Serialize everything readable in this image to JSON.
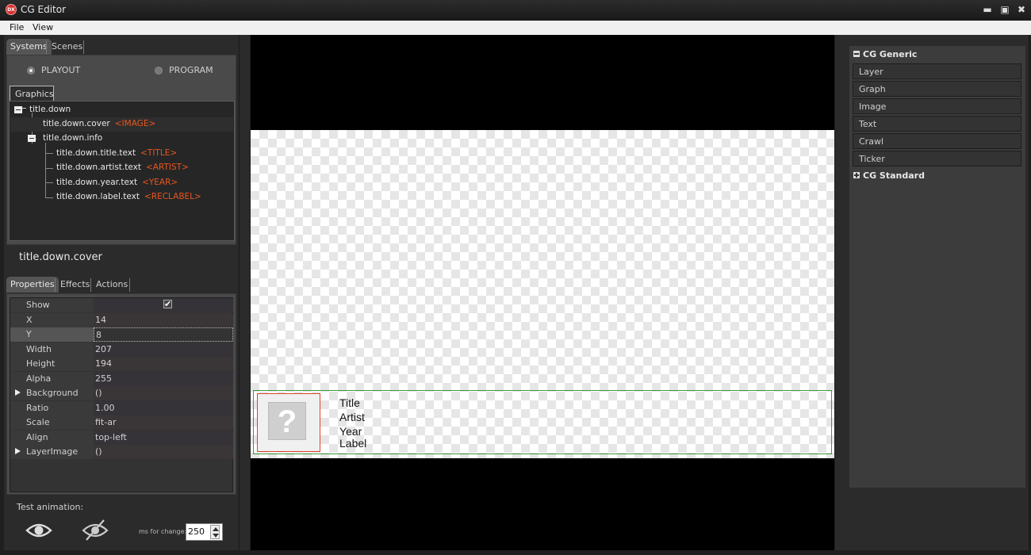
{
  "window": {
    "app_icon_label": "DX",
    "title": "CG Editor",
    "minimize_glyph": "▬",
    "maximize_glyph": "▣",
    "close_glyph": "✖"
  },
  "menu": [
    "File",
    "View"
  ],
  "left": {
    "top_tabs": [
      {
        "label": "Systems",
        "active": true
      },
      {
        "label": "Scenes",
        "active": false
      }
    ],
    "outputs": [
      {
        "label": "PLAYOUT",
        "checked": true
      },
      {
        "label": "PROGRAM",
        "checked": false
      }
    ],
    "graphics_tab": "Graphics",
    "tree": [
      {
        "name": "title.down",
        "tag": "",
        "depth": 0,
        "expanded": true
      },
      {
        "name": "title.down.cover",
        "tag": "<IMAGE>",
        "depth": 1,
        "selected": true
      },
      {
        "name": "title.down.info",
        "tag": "",
        "depth": 1,
        "expanded": true
      },
      {
        "name": "title.down.title.text",
        "tag": "<TITLE>",
        "depth": 2
      },
      {
        "name": "title.down.artist.text",
        "tag": "<ARTIST>",
        "depth": 2
      },
      {
        "name": "title.down.year.text",
        "tag": "<YEAR>",
        "depth": 2
      },
      {
        "name": "title.down.label.text",
        "tag": "<RECLABEL>",
        "depth": 2
      }
    ],
    "selected_title": "title.down.cover",
    "props_tabs": [
      {
        "label": "Properties",
        "active": true
      },
      {
        "label": "Effects",
        "active": false
      },
      {
        "label": "Actions",
        "active": false
      }
    ],
    "properties": [
      {
        "name": "Show",
        "value": "",
        "checkbox": true,
        "checked": true
      },
      {
        "name": "X",
        "value": "14"
      },
      {
        "name": "Y",
        "value": "8",
        "selected": true
      },
      {
        "name": "Width",
        "value": "207"
      },
      {
        "name": "Height",
        "value": "194"
      },
      {
        "name": "Alpha",
        "value": "255"
      },
      {
        "name": "Background",
        "value": "()",
        "expandable": true
      },
      {
        "name": "Ratio",
        "value": "1.00"
      },
      {
        "name": "Scale",
        "value": "fit-ar"
      },
      {
        "name": "Align",
        "value": "top-left"
      },
      {
        "name": "LayerImage",
        "value": "()",
        "expandable": true
      }
    ],
    "animation": {
      "label": "Test animation:",
      "show_icon": "eye-icon",
      "hide_icon": "eye-slash-icon",
      "ms_label": "ms for change:",
      "ms_value": "250"
    }
  },
  "preview": {
    "cover_placeholder": "?",
    "info_lines": [
      "Title",
      "Artist",
      "Year",
      "Label"
    ],
    "colors": {
      "selection_border": "#e0412c",
      "layer_border": "#3a9a3a"
    }
  },
  "right": {
    "groups": [
      {
        "label": "CG Generic",
        "expanded": true,
        "items": [
          "Layer",
          "Graph",
          "Image",
          "Text",
          "Crawl",
          "Ticker"
        ]
      },
      {
        "label": "CG Standard",
        "expanded": false,
        "items": []
      }
    ]
  },
  "colors": {
    "tag_accent": "#e8561e",
    "panel_bg": "#2b2b2b"
  }
}
